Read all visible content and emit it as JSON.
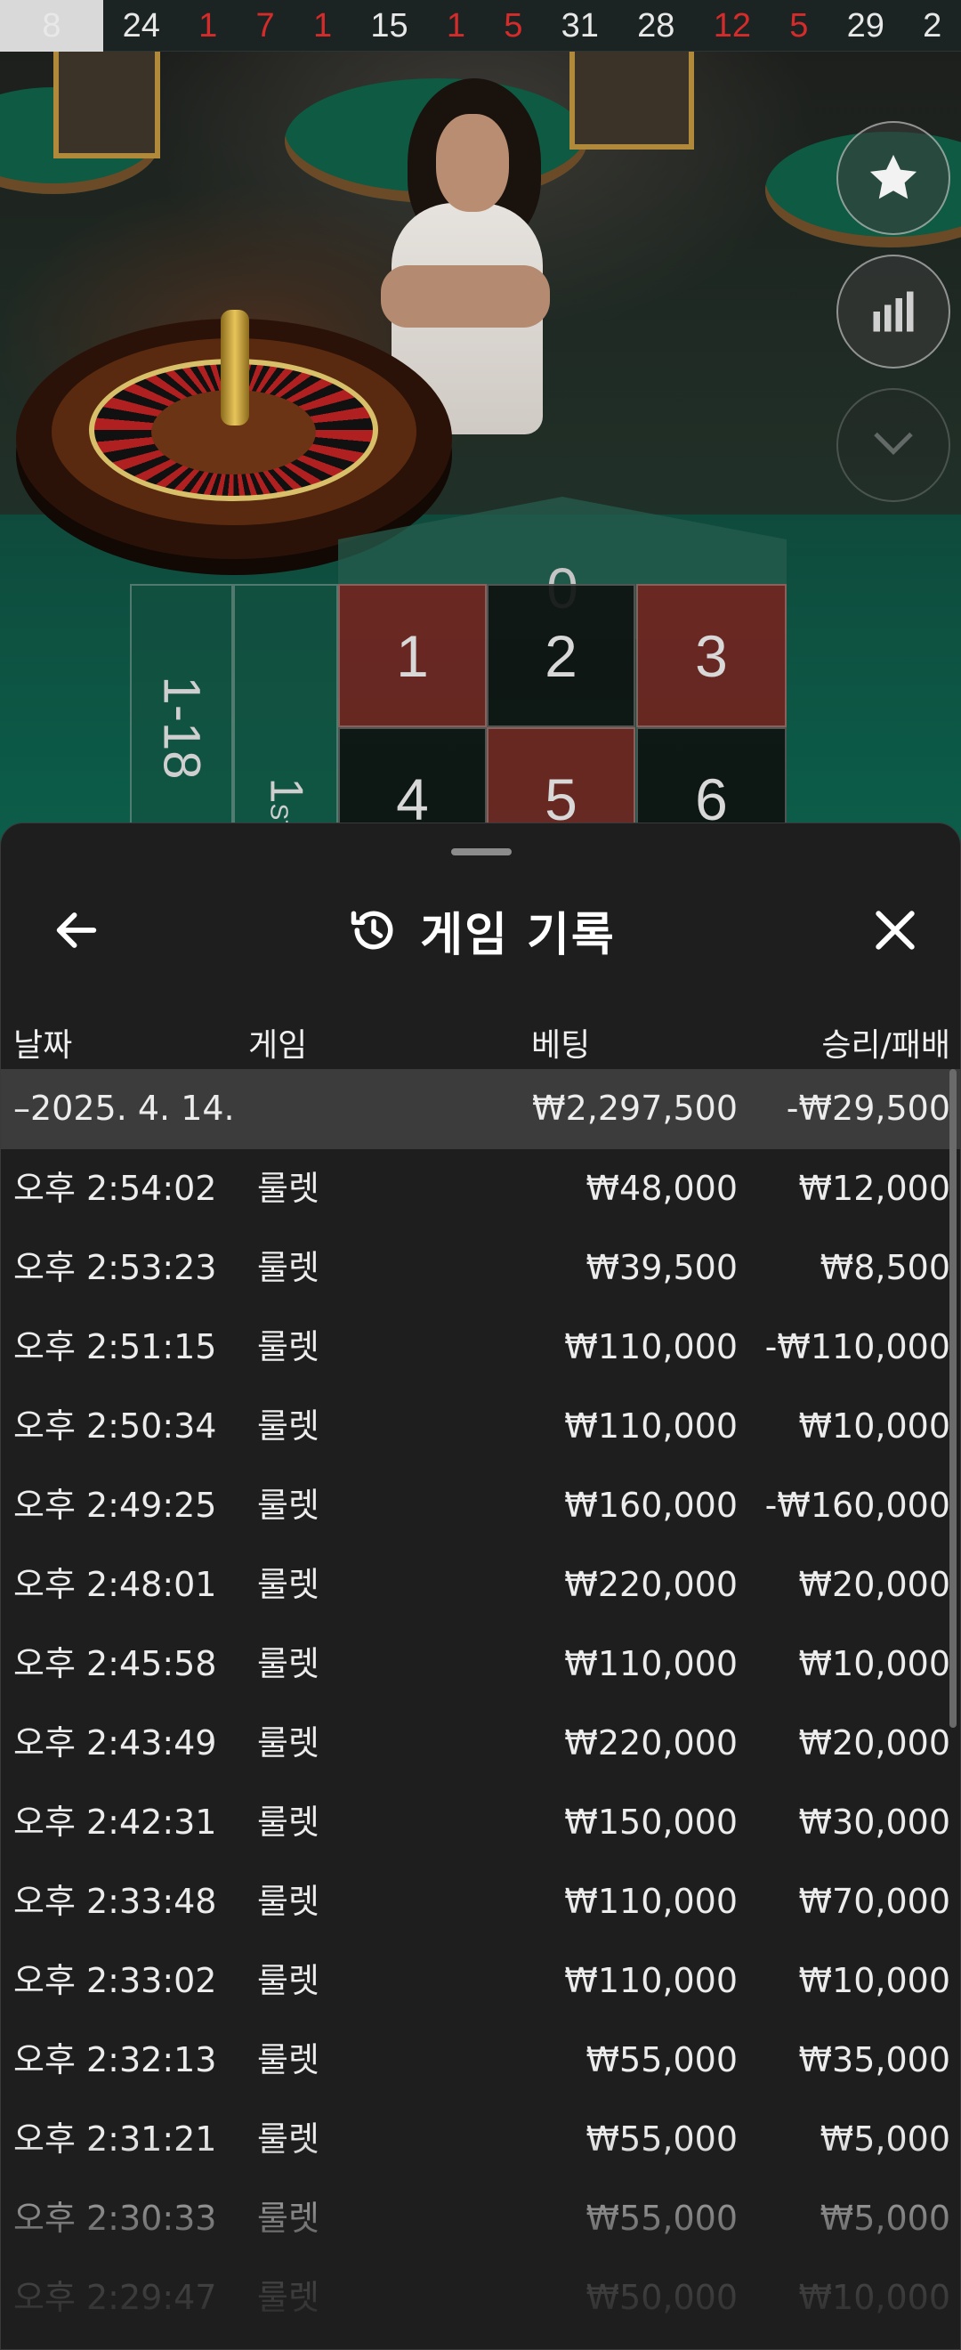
{
  "result_history": [
    {
      "value": "8",
      "color": "black",
      "highlight": true
    },
    {
      "value": "24",
      "color": "black"
    },
    {
      "value": "1",
      "color": "red"
    },
    {
      "value": "7",
      "color": "red"
    },
    {
      "value": "1",
      "color": "red"
    },
    {
      "value": "15",
      "color": "black"
    },
    {
      "value": "1",
      "color": "red"
    },
    {
      "value": "5",
      "color": "red"
    },
    {
      "value": "31",
      "color": "black"
    },
    {
      "value": "28",
      "color": "black"
    },
    {
      "value": "12",
      "color": "red"
    },
    {
      "value": "5",
      "color": "red"
    },
    {
      "value": "29",
      "color": "black"
    },
    {
      "value": "2",
      "color": "black"
    }
  ],
  "side_buttons": {
    "favorite_icon": "star-icon",
    "stats_icon": "bar-chart-icon",
    "collapse_icon": "chevron-down-icon"
  },
  "betting_grid": {
    "zero": "0",
    "range_low": "1-18",
    "dozen": "1",
    "dozen_suffix": "ST",
    "numbers": [
      {
        "value": "1",
        "color": "red"
      },
      {
        "value": "2",
        "color": "black"
      },
      {
        "value": "3",
        "color": "red"
      },
      {
        "value": "4",
        "color": "black"
      },
      {
        "value": "5",
        "color": "red"
      },
      {
        "value": "6",
        "color": "black"
      }
    ]
  },
  "history": {
    "title": "게임 기록",
    "title_icon": "history-icon",
    "back_icon": "arrow-left-icon",
    "close_icon": "close-icon",
    "columns": {
      "date": "날짜",
      "game": "게임",
      "bet": "베팅",
      "win_loss": "승리/패배"
    },
    "summary": {
      "date": "–2025. 4. 14.",
      "bet": "₩2,297,500",
      "win_loss": "-₩29,500"
    },
    "rows": [
      {
        "time": "오후 2:54:02",
        "game": "룰렛",
        "bet": "₩48,000",
        "win_loss": "₩12,000"
      },
      {
        "time": "오후 2:53:23",
        "game": "룰렛",
        "bet": "₩39,500",
        "win_loss": "₩8,500"
      },
      {
        "time": "오후 2:51:15",
        "game": "룰렛",
        "bet": "₩110,000",
        "win_loss": "-₩110,000"
      },
      {
        "time": "오후 2:50:34",
        "game": "룰렛",
        "bet": "₩110,000",
        "win_loss": "₩10,000"
      },
      {
        "time": "오후 2:49:25",
        "game": "룰렛",
        "bet": "₩160,000",
        "win_loss": "-₩160,000"
      },
      {
        "time": "오후 2:48:01",
        "game": "룰렛",
        "bet": "₩220,000",
        "win_loss": "₩20,000"
      },
      {
        "time": "오후 2:45:58",
        "game": "룰렛",
        "bet": "₩110,000",
        "win_loss": "₩10,000"
      },
      {
        "time": "오후 2:43:49",
        "game": "룰렛",
        "bet": "₩220,000",
        "win_loss": "₩20,000"
      },
      {
        "time": "오후 2:42:31",
        "game": "룰렛",
        "bet": "₩150,000",
        "win_loss": "₩30,000"
      },
      {
        "time": "오후 2:33:48",
        "game": "룰렛",
        "bet": "₩110,000",
        "win_loss": "₩70,000"
      },
      {
        "time": "오후 2:33:02",
        "game": "룰렛",
        "bet": "₩110,000",
        "win_loss": "₩10,000"
      },
      {
        "time": "오후 2:32:13",
        "game": "룰렛",
        "bet": "₩55,000",
        "win_loss": "₩35,000"
      },
      {
        "time": "오후 2:31:21",
        "game": "룰렛",
        "bet": "₩55,000",
        "win_loss": "₩5,000"
      },
      {
        "time": "오후 2:30:33",
        "game": "룰렛",
        "bet": "₩55,000",
        "win_loss": "₩5,000"
      },
      {
        "time": "오후 2:29:47",
        "game": "룰렛",
        "bet": "₩50,000",
        "win_loss": "₩10,000"
      }
    ]
  },
  "colors": {
    "red_number": "#d62b2b",
    "sheet_background": "#1e1e1e",
    "summary_row": "#3c3c3c"
  }
}
